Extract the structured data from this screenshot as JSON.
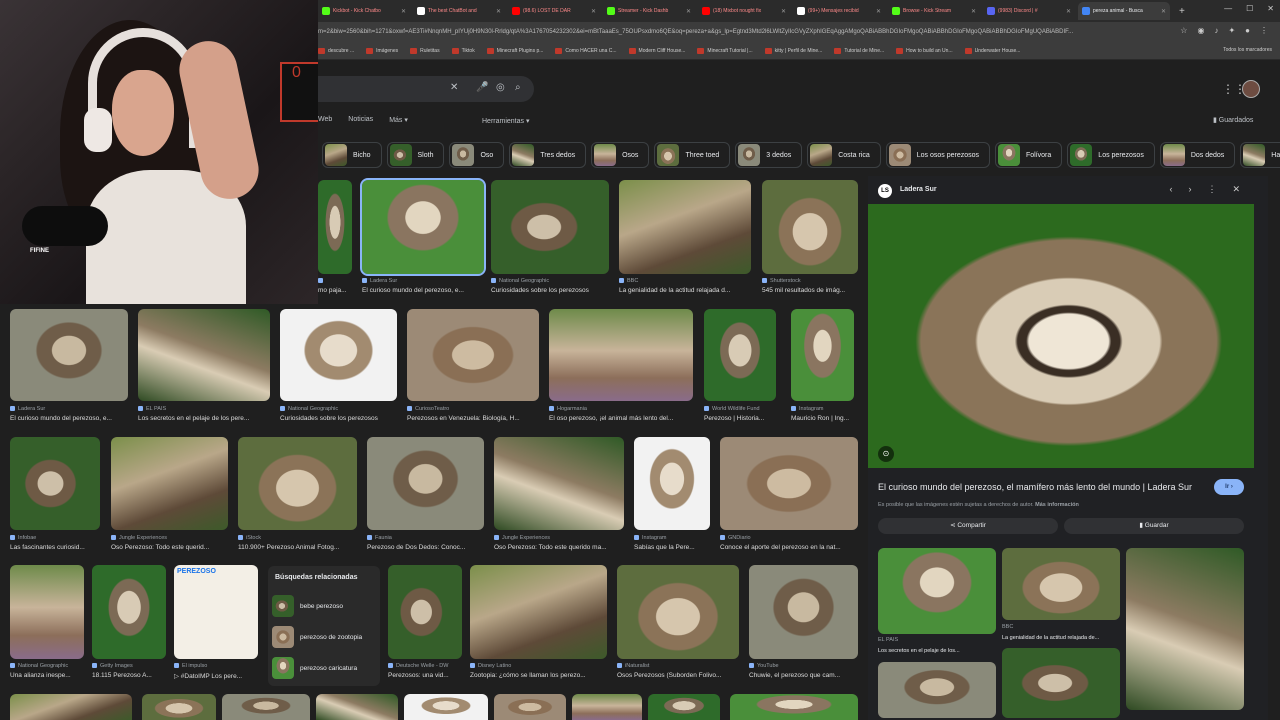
{
  "browser": {
    "tabs": [
      {
        "label": "Kickbot - Kick Chatbo",
        "color": "#53fc18"
      },
      {
        "label": "The best ChatBot and",
        "color": "#ffffff"
      },
      {
        "label": "(98.6) LOST DE DAR",
        "color": "#ff0000"
      },
      {
        "label": "Streamer - Kick Dashb",
        "color": "#53fc18"
      },
      {
        "label": "(18) Mixbot nought fix",
        "color": "#ff0000"
      },
      {
        "label": "(99+) Mensajes recibid",
        "color": "#ffffff"
      },
      {
        "label": "Browse - Kick Stream",
        "color": "#53fc18"
      },
      {
        "label": "(9983) Discord | #",
        "color": "#5865f2"
      },
      {
        "label": "pereza animal - Busca",
        "color": "#4285f4"
      }
    ],
    "url": "m=2&biw=2560&bih=1271&oxwf=AE3Ti#NnqnMH_pIYUj0H9N30l-Rrldg/qtA%3A1767054232302&ei=mBtTaaaEs_75OUPsxdmo6QE&oq=pereza+a&gs_lp=Egtnd3Mtd2l6LWltZyIIcGVyZXphIGEqAggAMgoQABiABBhDGIoFMgoQABiABBhDGIoFMgoQABiABBhDGIoFMgUQABiABDIF...",
    "bookmarks": [
      "descubre ...",
      "Imágenes",
      "Ruletitas",
      "Tiktok",
      "Minecraft Plugins p...",
      "Como HACER una C...",
      "Modern Cliff House...",
      "Minecraft Tutorial |...",
      "kitty | Perfil de Mine...",
      "Tutorial de Mine...",
      "How to build an Un...",
      "Underwater House..."
    ],
    "bookmarks_all": "Todos los marcadores"
  },
  "google": {
    "filters": [
      "Web",
      "Noticias",
      "Más"
    ],
    "tools": "Herramientas",
    "saved": "Guardados",
    "chips": [
      "Bicho",
      "Sloth",
      "Oso",
      "Tres dedos",
      "Osos",
      "Three toed",
      "3 dedos",
      "Costa rica",
      "Los osos perezosos",
      "Folívora",
      "Los perezosos",
      "Dos dedos",
      "Hatillo"
    ]
  },
  "results": {
    "row1": [
      {
        "source": "",
        "caption": "mo paja..."
      },
      {
        "source": "Ladera Sur",
        "caption": "El curioso mundo del perezoso, e..."
      },
      {
        "source": "National Geographic",
        "caption": "Curiosidades sobre los perezosos"
      },
      {
        "source": "BBC",
        "caption": "La genialidad de la actitud relajada d..."
      },
      {
        "source": "Shutterstock",
        "caption": "545 mil resultados de imág..."
      }
    ],
    "row2": [
      {
        "source": "Ladera Sur",
        "caption": "El curioso mundo del perezoso, e..."
      },
      {
        "source": "EL PAÍS",
        "caption": "Los secretos en el pelaje de los pere..."
      },
      {
        "source": "National Geographic",
        "caption": "Curiosidades sobre los perezosos"
      },
      {
        "source": "CuriosoTeatro",
        "caption": "Perezosos en Venezuela: Biología, H..."
      },
      {
        "source": "Hogarmania",
        "caption": "El oso perezoso, ¡el animal más lento del..."
      },
      {
        "source": "World Wildlife Fund",
        "caption": "Perezoso | Historia..."
      },
      {
        "source": "Instagram",
        "caption": "Mauricio Ron | Ing..."
      }
    ],
    "row3": [
      {
        "source": "Infobae",
        "caption": "Las fascinantes curiosid..."
      },
      {
        "source": "Jungle Experiences",
        "caption": "Oso Perezoso: Todo este querid..."
      },
      {
        "source": "iStock",
        "caption": "110.900+ Perezoso Animal Fotog..."
      },
      {
        "source": "Faunia",
        "caption": "Perezoso de Dos Dedos: Conoc..."
      },
      {
        "source": "Jungle Experiences",
        "caption": "Oso Perezoso: Todo este querido ma..."
      },
      {
        "source": "Instagram",
        "caption": "Sabías que la Pere..."
      },
      {
        "source": "GNDiario",
        "caption": "Conoce el aporte del perezoso en la nat..."
      }
    ],
    "row4": [
      {
        "source": "National Geographic",
        "caption": "Una alianza inespe..."
      },
      {
        "source": "Getty Images",
        "caption": "18.115 Perezoso A..."
      },
      {
        "source": "El impulso",
        "caption": "▷ #DatoIMP Los pere..."
      },
      {
        "source": "Deutsche Welle - DW",
        "caption": "Perezosos: una vid..."
      },
      {
        "source": "Disney Latino",
        "caption": "Zootopia: ¿cómo se llaman los perezo..."
      },
      {
        "source": "iNaturalist",
        "caption": "Osos Perezosos (Suborden Folivo..."
      },
      {
        "source": "YouTube",
        "caption": "Chuwie, el perezoso que cam..."
      }
    ],
    "related": {
      "title": "Búsquedas relacionadas",
      "items": [
        "bebe perezoso",
        "perezoso de zootopia",
        "perezoso caricatura"
      ]
    },
    "poster_text": "PEREZOSO"
  },
  "panel": {
    "site": "Ladera Sur",
    "favicon": "LS",
    "title": "El curioso mundo del perezoso, el mamífero más lento del mundo | Ladera Sur",
    "visit": "Ir",
    "legal": "Es posible que las imágenes estén sujetas a derechos de autor.",
    "legal_link": "Más información",
    "share": "Compartir",
    "save": "Guardar",
    "related": [
      {
        "source": "EL PAÍS",
        "caption": "Los secretos en el pelaje de los..."
      },
      {
        "source": "BBC",
        "caption": "La genialidad de la actitud relajada de..."
      }
    ]
  },
  "webcam": {
    "mic_label": "FIFINE",
    "light_text": "0"
  }
}
